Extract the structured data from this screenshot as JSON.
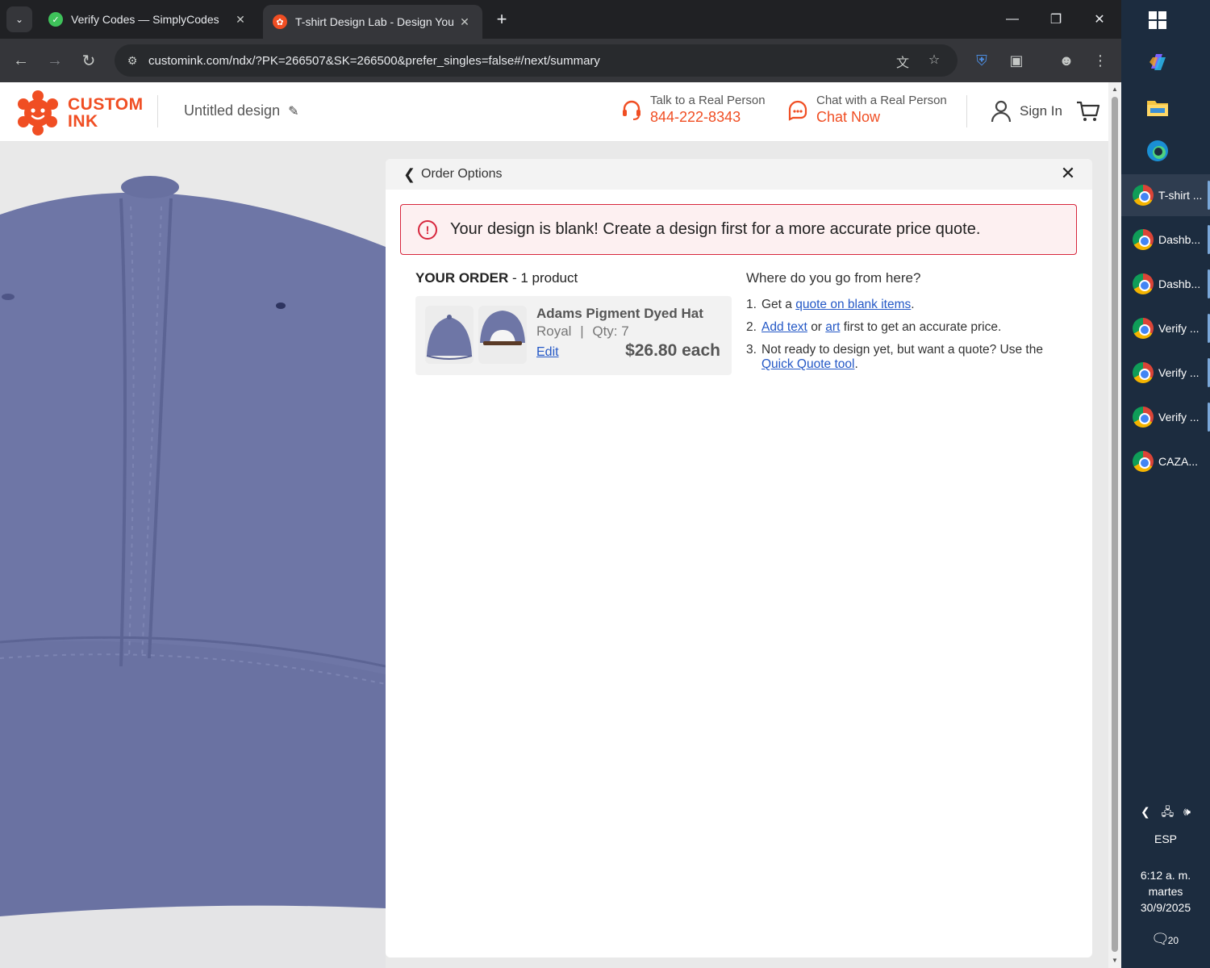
{
  "browser": {
    "tabs": [
      {
        "title": "Verify Codes — SimplyCodes",
        "active": false
      },
      {
        "title": "T-shirt Design Lab - Design You",
        "active": true
      }
    ],
    "url": "customink.com/ndx/?PK=266507&SK=266500&prefer_singles=false#/next/summary"
  },
  "header": {
    "logo_line1": "CUSTOM",
    "logo_line2": "INK",
    "design_name": "Untitled design",
    "phone_label": "Talk to a Real Person",
    "phone_number": "844-222-8343",
    "chat_label": "Chat with a Real Person",
    "chat_action": "Chat Now",
    "signin": "Sign In"
  },
  "panel": {
    "title": "Order Options",
    "alert": "Your design is blank! Create a design first for a more accurate price quote.",
    "order": {
      "heading_bold": "YOUR ORDER",
      "heading_rest": " - 1 product",
      "product_name": "Adams Pigment Dyed Hat",
      "color": "Royal",
      "separator": "|",
      "qty": "Qty: 7",
      "edit": "Edit",
      "price": "$26.80 each"
    },
    "next": {
      "heading": "Where do you go from here?",
      "step1_num": "1.",
      "step1_pre": "Get a",
      "step1_link": "quote on blank items",
      "step1_post": ".",
      "step2_num": "2.",
      "step2_link1": "Add text",
      "step2_mid": "or",
      "step2_link2": "art",
      "step2_post": "first to get an accurate price.",
      "step3_num": "3.",
      "step3_pre": "Not ready to design yet, but want a quote? Use the",
      "step3_link": "Quick Quote tool",
      "step3_post": "."
    }
  },
  "taskbar": {
    "items": [
      {
        "label": "T-shirt ...",
        "active": true
      },
      {
        "label": "Dashb...",
        "active": false
      },
      {
        "label": "Dashb...",
        "active": false
      },
      {
        "label": "Verify ...",
        "active": false
      },
      {
        "label": "Verify ...",
        "active": false
      },
      {
        "label": "Verify ...",
        "active": false
      },
      {
        "label": "CAZA...",
        "active": false
      }
    ],
    "language": "ESP",
    "time": "6:12 a. m.",
    "day": "martes",
    "date": "30/9/2025",
    "notifications": "20"
  },
  "colors": {
    "brand": "#f04e23",
    "link": "#2458c6",
    "alert_border": "#d7263d",
    "hat": "#6e76a6"
  }
}
